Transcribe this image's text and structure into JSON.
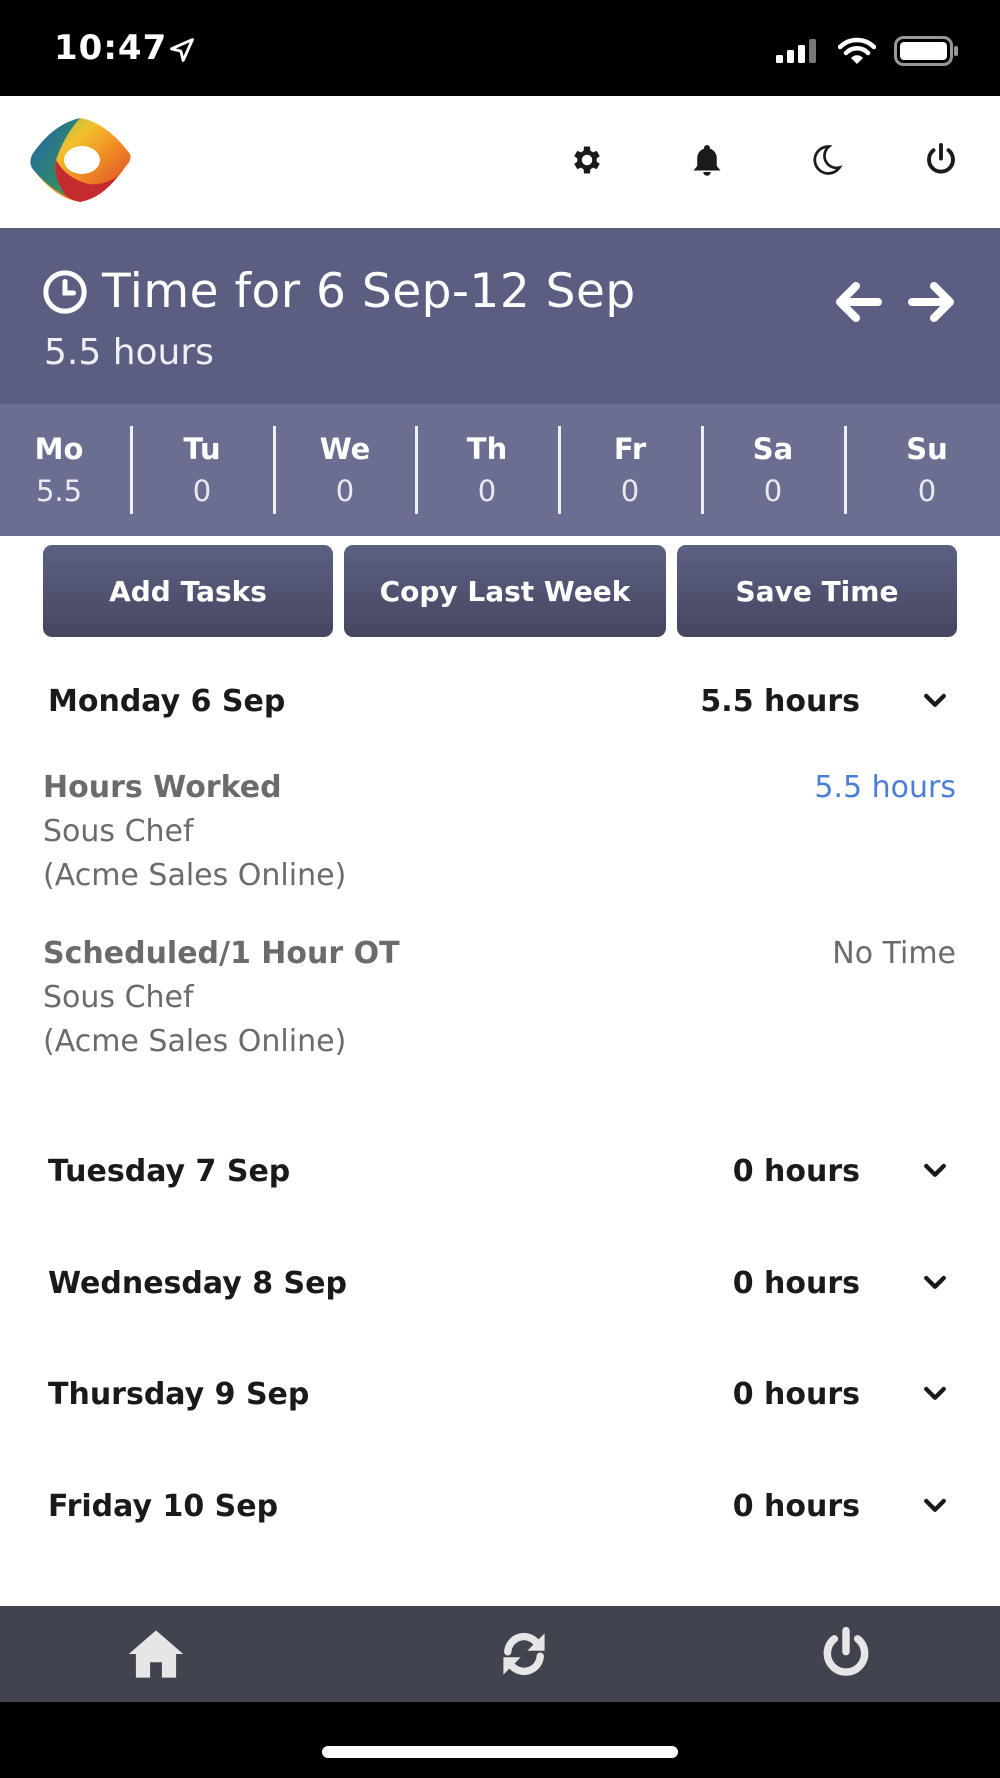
{
  "status_bar": {
    "time": "10:47"
  },
  "header": {
    "icons": [
      "settings-gear-icon",
      "bell-icon",
      "moon-icon",
      "power-icon"
    ]
  },
  "week": {
    "title": "Time for 6 Sep-12 Sep",
    "total": "5.5 hours",
    "days": [
      {
        "name": "Mo",
        "value": "5.5"
      },
      {
        "name": "Tu",
        "value": "0"
      },
      {
        "name": "We",
        "value": "0"
      },
      {
        "name": "Th",
        "value": "0"
      },
      {
        "name": "Fr",
        "value": "0"
      },
      {
        "name": "Sa",
        "value": "0"
      },
      {
        "name": "Su",
        "value": "0"
      }
    ]
  },
  "actions": {
    "add_tasks": "Add Tasks",
    "copy_last_week": "Copy Last Week",
    "save_time": "Save Time"
  },
  "day_sections": [
    {
      "label": "Monday 6 Sep",
      "total": "5.5 hours"
    },
    {
      "label": "Tuesday 7 Sep",
      "total": "0 hours"
    },
    {
      "label": "Wednesday 8 Sep",
      "total": "0 hours"
    },
    {
      "label": "Thursday 9 Sep",
      "total": "0 hours"
    },
    {
      "label": "Friday 10 Sep",
      "total": "0 hours"
    }
  ],
  "monday_entries": [
    {
      "title": "Hours Worked",
      "role": "Sous Chef",
      "org": "(Acme Sales Online)",
      "value": "5.5 hours",
      "value_color": "#4a7fd4"
    },
    {
      "title": "Scheduled/1 Hour OT",
      "role": "Sous Chef",
      "org": "(Acme Sales Online)",
      "value": "No Time",
      "value_color": "#6b6b6b"
    }
  ],
  "colors": {
    "week_header": "#5b5e80",
    "day_strip": "#6b6e90",
    "bottom_nav": "#41434f",
    "link_blue": "#4a7fd4"
  }
}
